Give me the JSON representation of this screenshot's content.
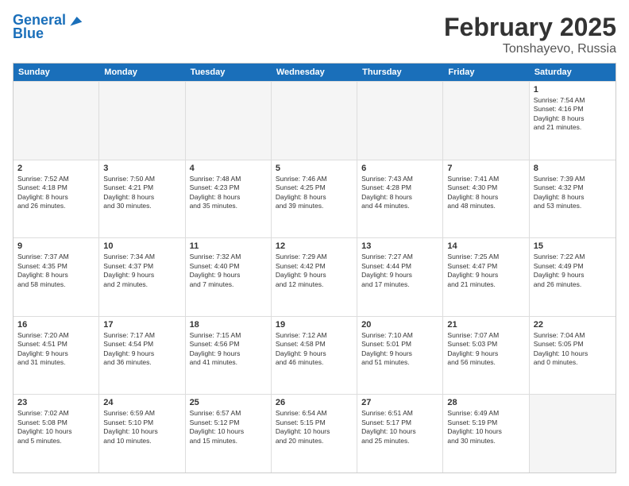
{
  "header": {
    "logo_line1": "General",
    "logo_line2": "Blue",
    "title": "February 2025",
    "subtitle": "Tonshayevo, Russia"
  },
  "weekdays": [
    "Sunday",
    "Monday",
    "Tuesday",
    "Wednesday",
    "Thursday",
    "Friday",
    "Saturday"
  ],
  "rows": [
    [
      {
        "day": "",
        "text": ""
      },
      {
        "day": "",
        "text": ""
      },
      {
        "day": "",
        "text": ""
      },
      {
        "day": "",
        "text": ""
      },
      {
        "day": "",
        "text": ""
      },
      {
        "day": "",
        "text": ""
      },
      {
        "day": "1",
        "text": "Sunrise: 7:54 AM\nSunset: 4:16 PM\nDaylight: 8 hours\nand 21 minutes."
      }
    ],
    [
      {
        "day": "2",
        "text": "Sunrise: 7:52 AM\nSunset: 4:18 PM\nDaylight: 8 hours\nand 26 minutes."
      },
      {
        "day": "3",
        "text": "Sunrise: 7:50 AM\nSunset: 4:21 PM\nDaylight: 8 hours\nand 30 minutes."
      },
      {
        "day": "4",
        "text": "Sunrise: 7:48 AM\nSunset: 4:23 PM\nDaylight: 8 hours\nand 35 minutes."
      },
      {
        "day": "5",
        "text": "Sunrise: 7:46 AM\nSunset: 4:25 PM\nDaylight: 8 hours\nand 39 minutes."
      },
      {
        "day": "6",
        "text": "Sunrise: 7:43 AM\nSunset: 4:28 PM\nDaylight: 8 hours\nand 44 minutes."
      },
      {
        "day": "7",
        "text": "Sunrise: 7:41 AM\nSunset: 4:30 PM\nDaylight: 8 hours\nand 48 minutes."
      },
      {
        "day": "8",
        "text": "Sunrise: 7:39 AM\nSunset: 4:32 PM\nDaylight: 8 hours\nand 53 minutes."
      }
    ],
    [
      {
        "day": "9",
        "text": "Sunrise: 7:37 AM\nSunset: 4:35 PM\nDaylight: 8 hours\nand 58 minutes."
      },
      {
        "day": "10",
        "text": "Sunrise: 7:34 AM\nSunset: 4:37 PM\nDaylight: 9 hours\nand 2 minutes."
      },
      {
        "day": "11",
        "text": "Sunrise: 7:32 AM\nSunset: 4:40 PM\nDaylight: 9 hours\nand 7 minutes."
      },
      {
        "day": "12",
        "text": "Sunrise: 7:29 AM\nSunset: 4:42 PM\nDaylight: 9 hours\nand 12 minutes."
      },
      {
        "day": "13",
        "text": "Sunrise: 7:27 AM\nSunset: 4:44 PM\nDaylight: 9 hours\nand 17 minutes."
      },
      {
        "day": "14",
        "text": "Sunrise: 7:25 AM\nSunset: 4:47 PM\nDaylight: 9 hours\nand 21 minutes."
      },
      {
        "day": "15",
        "text": "Sunrise: 7:22 AM\nSunset: 4:49 PM\nDaylight: 9 hours\nand 26 minutes."
      }
    ],
    [
      {
        "day": "16",
        "text": "Sunrise: 7:20 AM\nSunset: 4:51 PM\nDaylight: 9 hours\nand 31 minutes."
      },
      {
        "day": "17",
        "text": "Sunrise: 7:17 AM\nSunset: 4:54 PM\nDaylight: 9 hours\nand 36 minutes."
      },
      {
        "day": "18",
        "text": "Sunrise: 7:15 AM\nSunset: 4:56 PM\nDaylight: 9 hours\nand 41 minutes."
      },
      {
        "day": "19",
        "text": "Sunrise: 7:12 AM\nSunset: 4:58 PM\nDaylight: 9 hours\nand 46 minutes."
      },
      {
        "day": "20",
        "text": "Sunrise: 7:10 AM\nSunset: 5:01 PM\nDaylight: 9 hours\nand 51 minutes."
      },
      {
        "day": "21",
        "text": "Sunrise: 7:07 AM\nSunset: 5:03 PM\nDaylight: 9 hours\nand 56 minutes."
      },
      {
        "day": "22",
        "text": "Sunrise: 7:04 AM\nSunset: 5:05 PM\nDaylight: 10 hours\nand 0 minutes."
      }
    ],
    [
      {
        "day": "23",
        "text": "Sunrise: 7:02 AM\nSunset: 5:08 PM\nDaylight: 10 hours\nand 5 minutes."
      },
      {
        "day": "24",
        "text": "Sunrise: 6:59 AM\nSunset: 5:10 PM\nDaylight: 10 hours\nand 10 minutes."
      },
      {
        "day": "25",
        "text": "Sunrise: 6:57 AM\nSunset: 5:12 PM\nDaylight: 10 hours\nand 15 minutes."
      },
      {
        "day": "26",
        "text": "Sunrise: 6:54 AM\nSunset: 5:15 PM\nDaylight: 10 hours\nand 20 minutes."
      },
      {
        "day": "27",
        "text": "Sunrise: 6:51 AM\nSunset: 5:17 PM\nDaylight: 10 hours\nand 25 minutes."
      },
      {
        "day": "28",
        "text": "Sunrise: 6:49 AM\nSunset: 5:19 PM\nDaylight: 10 hours\nand 30 minutes."
      },
      {
        "day": "",
        "text": ""
      }
    ]
  ]
}
